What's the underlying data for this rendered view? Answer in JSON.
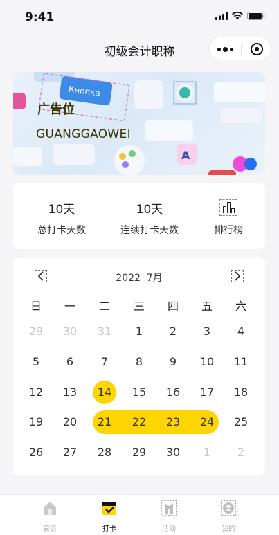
{
  "status_bar": {
    "time": "9:41"
  },
  "nav": {
    "title": "初级会计职称"
  },
  "banner": {
    "title": "广告位",
    "subtitle": "GUANGGAOWEI",
    "key_text": "Кнопка"
  },
  "stats": {
    "total_value": "10天",
    "total_label": "总打卡天数",
    "streak_value": "10天",
    "streak_label": "连续打卡天数",
    "ranking_label": "排行榜"
  },
  "calendar": {
    "year_month": "2022  7月",
    "weekdays": [
      "日",
      "一",
      "二",
      "三",
      "四",
      "五",
      "六"
    ],
    "weeks": [
      [
        "29",
        "30",
        "31",
        "1",
        "2",
        "3",
        "4"
      ],
      [
        "5",
        "6",
        "7",
        "8",
        "9",
        "10",
        "11"
      ],
      [
        "12",
        "13",
        "14",
        "15",
        "16",
        "17",
        "18"
      ],
      [
        "19",
        "20",
        "21",
        "22",
        "23",
        "24",
        "25"
      ],
      [
        "26",
        "27",
        "28",
        "29",
        "30",
        "1",
        "2"
      ]
    ],
    "highlight_color": "#ffd500"
  },
  "tabs": [
    {
      "label": "首页",
      "icon": "home-icon"
    },
    {
      "label": "打卡",
      "icon": "checkin-icon",
      "active": true
    },
    {
      "label": "活动",
      "icon": "activity-icon"
    },
    {
      "label": "我的",
      "icon": "profile-icon"
    }
  ]
}
